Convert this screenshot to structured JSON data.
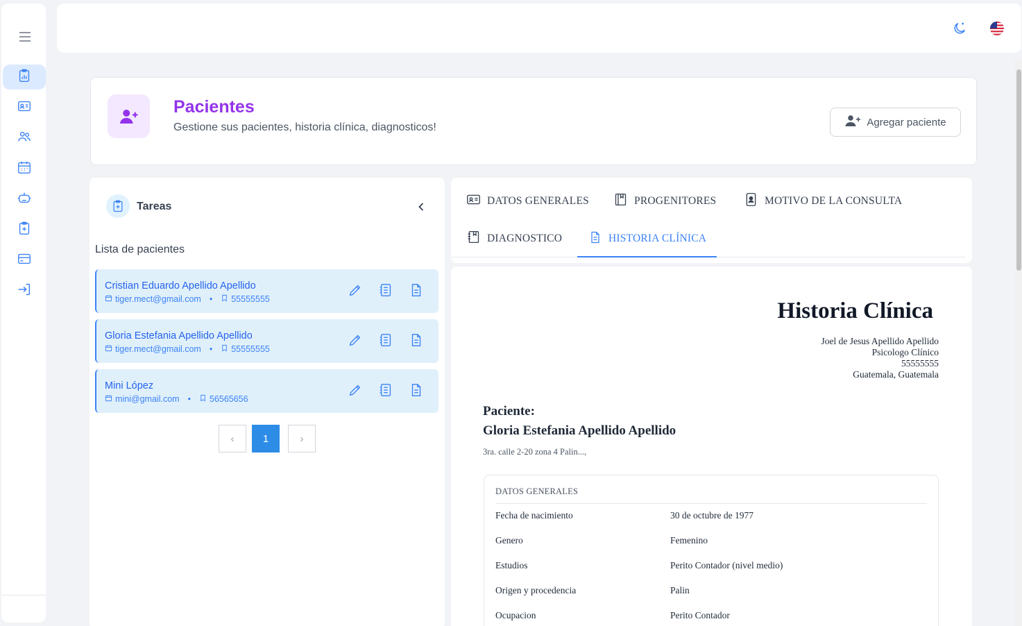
{
  "sidebar": {
    "items": [
      {
        "icon": "clipboard-chart-icon",
        "active": true
      },
      {
        "icon": "id-card-icon",
        "active": false
      },
      {
        "icon": "users-icon",
        "active": false
      },
      {
        "icon": "calendar-icon",
        "active": false
      },
      {
        "icon": "robot-icon",
        "active": false
      },
      {
        "icon": "clipboard-plus-icon",
        "active": false
      },
      {
        "icon": "credit-card-icon",
        "active": false
      },
      {
        "icon": "logout-icon",
        "active": false
      }
    ]
  },
  "topbar": {
    "icons": [
      "moon-icon",
      "us-flag-icon"
    ]
  },
  "header": {
    "title": "Pacientes",
    "subtitle": "Gestione sus pacientes, historia clínica, diagnosticos!",
    "add_button": "Agregar paciente"
  },
  "left_panel": {
    "title": "Tareas",
    "list_title": "Lista de pacientes",
    "patients": [
      {
        "name": "Cristian Eduardo Apellido Apellido",
        "email": "tiger.mect@gmail.com",
        "phone": "55555555"
      },
      {
        "name": "Gloria Estefania Apellido Apellido",
        "email": "tiger.mect@gmail.com",
        "phone": "55555555"
      },
      {
        "name": "Mini López",
        "email": "mini@gmail.com",
        "phone": "56565656"
      }
    ],
    "pagination": {
      "prev": "‹",
      "current": "1",
      "next": "›"
    }
  },
  "tabs": [
    {
      "label": "DATOS GENERALES",
      "icon": "id-card-icon",
      "active": false
    },
    {
      "label": "PROGENITORES",
      "icon": "book-icon",
      "active": false
    },
    {
      "label": "MOTIVO DE LA CONSULTA",
      "icon": "contact-icon",
      "active": false
    },
    {
      "label": "DIAGNOSTICO",
      "icon": "notebook-icon",
      "active": false
    },
    {
      "label": "HISTORIA CLÍNICA",
      "icon": "document-icon",
      "active": true
    }
  ],
  "document": {
    "title": "Historia Clínica",
    "doctor": {
      "name": "Joel de Jesus Apellido Apellido",
      "title": "Psicologo Clínico",
      "phone": "55555555",
      "location": "Guatemala, Guatemala"
    },
    "patient_label": "Paciente:",
    "patient_name": "Gloria Estefania Apellido Apellido",
    "address": "3ra. calle 2-20 zona 4 Palin...,",
    "general": {
      "title": "DATOS GENERALES",
      "rows": [
        {
          "label": "Fecha de nacimiento",
          "value": "30 de octubre de 1977"
        },
        {
          "label": "Genero",
          "value": "Femenino"
        },
        {
          "label": "Estudios",
          "value": "Perito Contador (nivel medio)"
        },
        {
          "label": "Origen y procedencia",
          "value": "Palin"
        },
        {
          "label": "Ocupacion",
          "value": "Perito Contador"
        }
      ]
    }
  },
  "colors": {
    "accent": "#3b82f6",
    "brand": "#9333ea",
    "brand_bg": "#f3e8ff",
    "card_bg": "#e0f0fb"
  }
}
